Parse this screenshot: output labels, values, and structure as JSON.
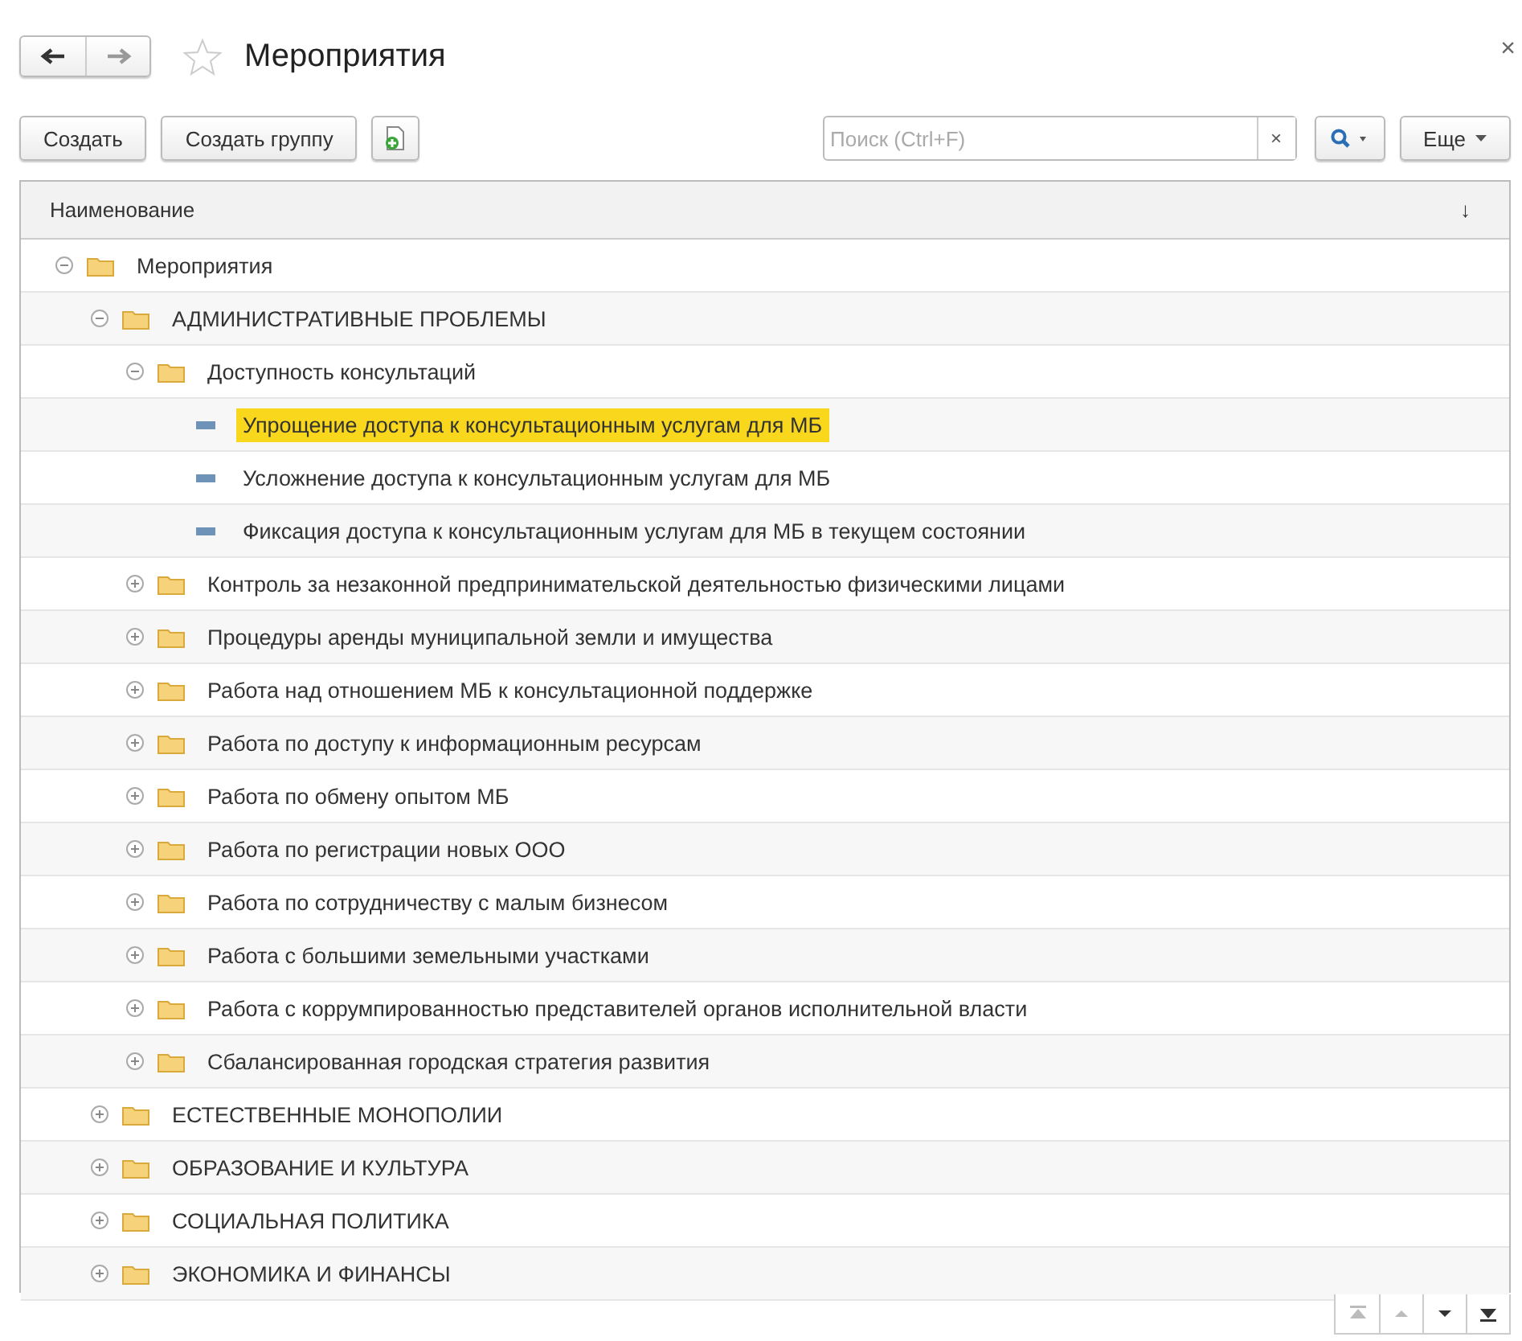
{
  "window": {
    "title": "Мероприятия",
    "favorite": false,
    "close": "×"
  },
  "toolbar": {
    "buttons": [
      "Создать",
      "Создать группу"
    ],
    "search": {
      "placeholder": "Поиск (Ctrl+F)",
      "clear": "×"
    },
    "more": "Еще"
  },
  "table": {
    "columns": [
      {
        "label": "Наименование",
        "sort": "↓"
      }
    ],
    "tree": [
      {
        "label": "Мероприятия",
        "kind": "folder",
        "expanded": true,
        "selected": false,
        "children": [
          {
            "label": "АДМИНИСТРАТИВНЫЕ ПРОБЛЕМЫ",
            "kind": "folder",
            "expanded": true,
            "selected": false,
            "children": [
              {
                "label": "Доступность консультаций",
                "kind": "folder",
                "expanded": true,
                "selected": false,
                "children": [
                  {
                    "label": "Упрощение доступа к консультационным услугам для МБ",
                    "kind": "item",
                    "selected": true
                  },
                  {
                    "label": "Усложнение доступа к консультационным услугам для МБ",
                    "kind": "item",
                    "selected": false
                  },
                  {
                    "label": "Фиксация доступа к консультационным услугам для МБ в текущем состоянии",
                    "kind": "item",
                    "selected": false
                  }
                ]
              },
              {
                "label": "Контроль за незаконной предпринимательской деятельностью физическими лицами",
                "kind": "folder",
                "expanded": false,
                "selected": false
              },
              {
                "label": "Процедуры аренды муниципальной земли и имущества",
                "kind": "folder",
                "expanded": false,
                "selected": false
              },
              {
                "label": "Работа над отношением МБ к консультационной поддержке",
                "kind": "folder",
                "expanded": false,
                "selected": false
              },
              {
                "label": "Работа по доступу к информационным ресурсам",
                "kind": "folder",
                "expanded": false,
                "selected": false
              },
              {
                "label": "Работа по обмену опытом МБ",
                "kind": "folder",
                "expanded": false,
                "selected": false
              },
              {
                "label": "Работа по регистрации новых ООО",
                "kind": "folder",
                "expanded": false,
                "selected": false
              },
              {
                "label": "Работа по сотрудничеству с малым бизнесом",
                "kind": "folder",
                "expanded": false,
                "selected": false
              },
              {
                "label": "Работа с большими земельными участками",
                "kind": "folder",
                "expanded": false,
                "selected": false
              },
              {
                "label": "Работа с коррумпированностью представителей органов исполнительной власти",
                "kind": "folder",
                "expanded": false,
                "selected": false
              },
              {
                "label": "Сбалансированная городская стратегия развития",
                "kind": "folder",
                "expanded": false,
                "selected": false
              }
            ]
          },
          {
            "label": "ЕСТЕСТВЕННЫЕ МОНОПОЛИИ",
            "kind": "folder",
            "expanded": false,
            "selected": false
          },
          {
            "label": "ОБРАЗОВАНИЕ И КУЛЬТУРА",
            "kind": "folder",
            "expanded": false,
            "selected": false
          },
          {
            "label": "СОЦИАЛЬНАЯ ПОЛИТИКА",
            "kind": "folder",
            "expanded": false,
            "selected": false
          },
          {
            "label": "ЭКОНОМИКА И ФИНАНСЫ",
            "kind": "folder",
            "expanded": false,
            "selected": false
          }
        ]
      }
    ]
  },
  "pager": [
    {
      "kind": "first",
      "disabled": true
    },
    {
      "kind": "up",
      "disabled": true
    },
    {
      "kind": "down",
      "disabled": false
    },
    {
      "kind": "last",
      "disabled": false
    }
  ]
}
